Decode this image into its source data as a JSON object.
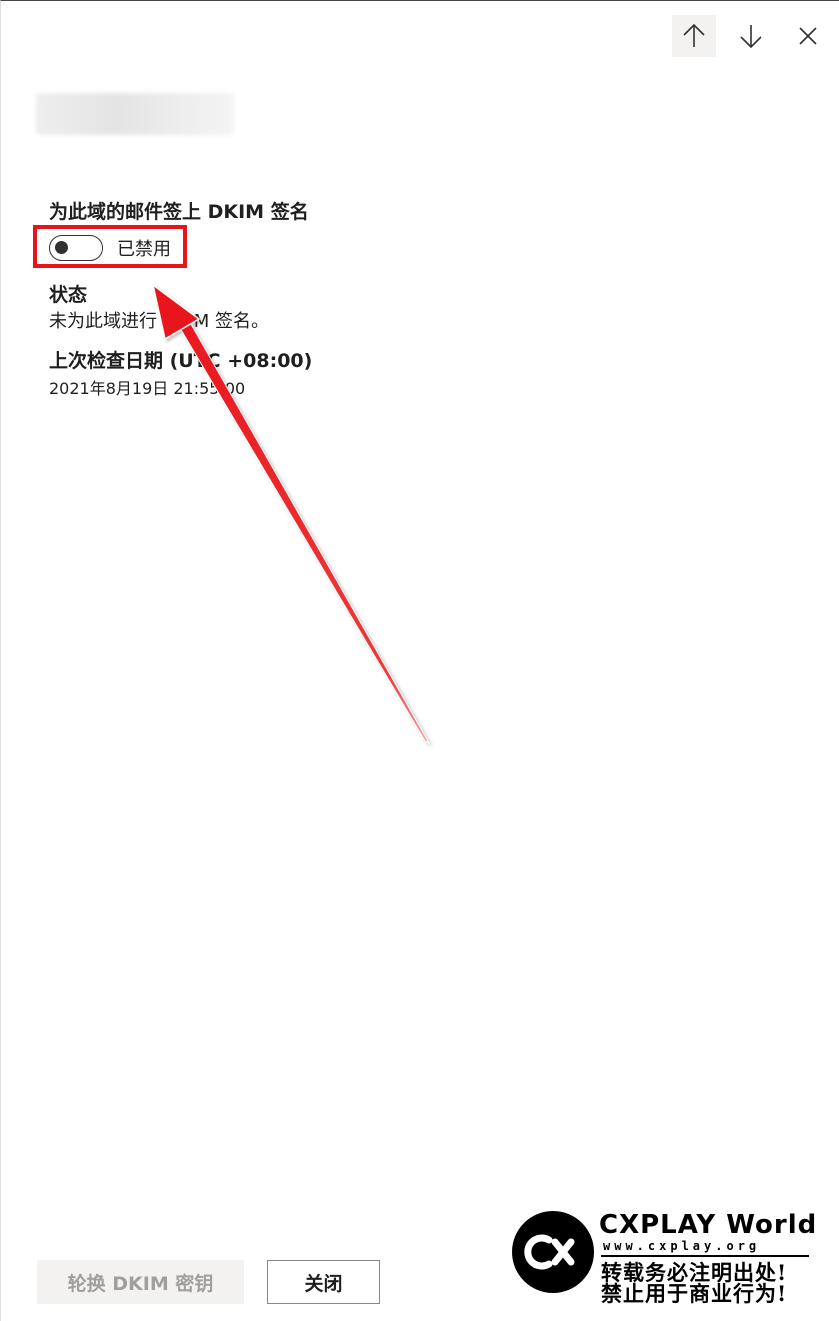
{
  "nav": {
    "up_icon": "arrow-up-icon",
    "down_icon": "arrow-down-icon",
    "close_icon": "close-icon"
  },
  "dkim": {
    "label": "为此域的邮件签上 DKIM 签名",
    "toggle_state": "off",
    "toggle_label": "已禁用"
  },
  "status": {
    "label": "状态",
    "value": "未为此域进行 DKIM 签名。"
  },
  "last_checked": {
    "label": "上次检查日期 (UTC +08:00)",
    "value": "2021年8月19日 21:55:00"
  },
  "footer": {
    "rotate_label": "轮换 DKIM 密钥",
    "close_label": "关闭"
  },
  "watermark": {
    "title": "CXPLAY World",
    "url": "www.cxplay.org",
    "line1": "转载务必注明出处!",
    "line2": "禁止用于商业行为!"
  },
  "colors": {
    "annotation": "#e8141c",
    "disabled_button_bg": "#f3f2f1",
    "disabled_text": "#a19f9d"
  }
}
